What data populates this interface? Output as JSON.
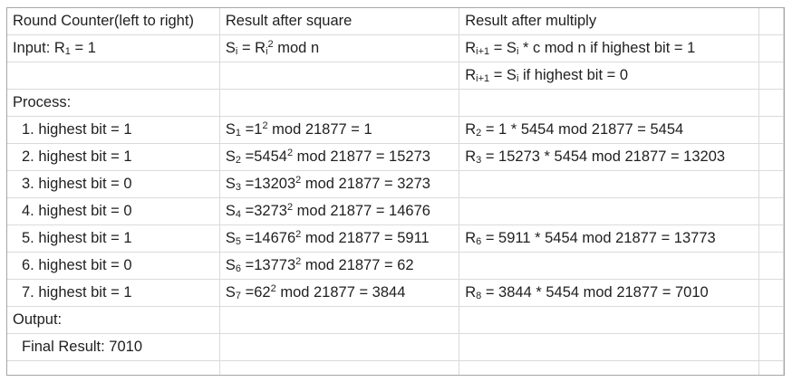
{
  "headers": {
    "round": "Round Counter(left to right)",
    "square": "Result after square",
    "multiply": "Result after multiply"
  },
  "input": {
    "label": "Input: R",
    "label_sub": "1",
    "label_tail": " = 1",
    "square_a": "S",
    "square_a_sub": "i",
    "square_b": " = R",
    "square_b_sub": "i",
    "square_b_sup": "2",
    "square_c": " mod n",
    "mult1_a": "R",
    "mult1_a_sub": "i+1",
    "mult1_b": " = S",
    "mult1_b_sub": "i",
    "mult1_c": " * c mod n if highest bit = 1",
    "mult2_a": "R",
    "mult2_a_sub": "i+1",
    "mult2_b": " = S",
    "mult2_b_sub": "i",
    "mult2_c": " if highest bit = 0"
  },
  "process_label": "Process:",
  "rounds": [
    {
      "round": "1. highest bit = 1",
      "s": "S",
      "s_sub": "1",
      "s_eq": " =1",
      "s_sup": "2",
      "s_tail": " mod 21877 = 1",
      "r": "R",
      "r_sub": "2",
      "r_tail": " = 1 * 5454 mod 21877 = 5454"
    },
    {
      "round": "2. highest bit = 1",
      "s": "S",
      "s_sub": "2",
      "s_eq": " =5454",
      "s_sup": "2",
      "s_tail": " mod 21877 = 15273",
      "r": "R",
      "r_sub": "3",
      "r_tail": " = 15273 * 5454 mod 21877 = 13203"
    },
    {
      "round": "3. highest bit = 0",
      "s": "S",
      "s_sub": "3",
      "s_eq": " =13203",
      "s_sup": "2",
      "s_tail": " mod 21877 = 3273",
      "r": "",
      "r_sub": "",
      "r_tail": ""
    },
    {
      "round": "4. highest bit = 0",
      "s": "S",
      "s_sub": "4",
      "s_eq": " =3273",
      "s_sup": "2",
      "s_tail": " mod 21877 = 14676",
      "r": "",
      "r_sub": "",
      "r_tail": ""
    },
    {
      "round": "5. highest bit = 1",
      "s": "S",
      "s_sub": "5",
      "s_eq": " =14676",
      "s_sup": "2",
      "s_tail": " mod 21877 = 5911",
      "r": "R",
      "r_sub": "6",
      "r_tail": " = 5911 * 5454 mod 21877 = 13773"
    },
    {
      "round": "6. highest bit = 0",
      "s": "S",
      "s_sub": "6",
      "s_eq": " =13773",
      "s_sup": "2",
      "s_tail": " mod 21877 = 62",
      "r": "",
      "r_sub": "",
      "r_tail": ""
    },
    {
      "round": "7. highest bit = 1",
      "s": "S",
      "s_sub": "7",
      "s_eq": " =62",
      "s_sup": "2",
      "s_tail": " mod 21877 = 3844",
      "r": "R",
      "r_sub": "8",
      "r_tail": " = 3844 * 5454 mod 21877 = 7010"
    }
  ],
  "output_label": "Output:",
  "final_result": "Final Result: 7010"
}
